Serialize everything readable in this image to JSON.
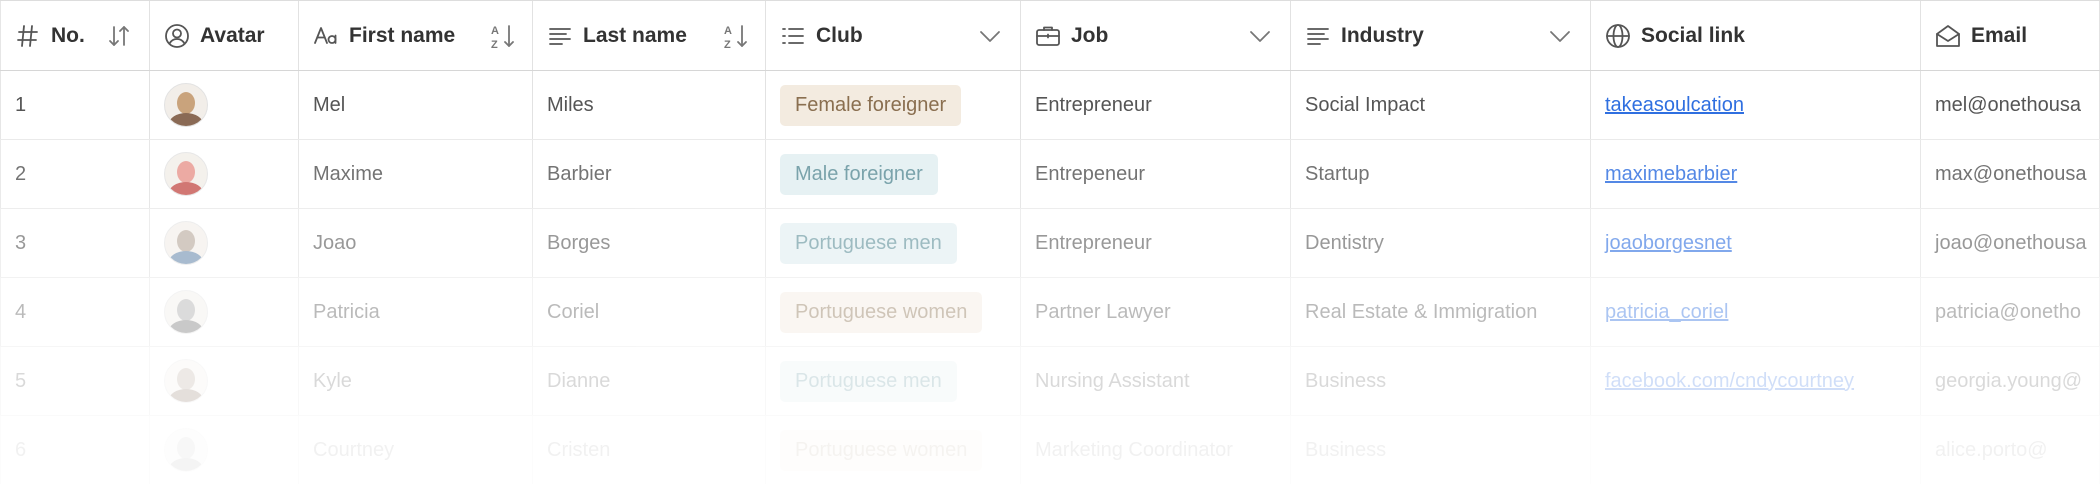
{
  "columns": [
    {
      "key": "no",
      "label": "No.",
      "icon": "hash-icon",
      "action": "sort-icon"
    },
    {
      "key": "avatar",
      "label": "Avatar",
      "icon": "user-circle-icon",
      "action": ""
    },
    {
      "key": "first_name",
      "label": "First name",
      "icon": "text-aa-icon",
      "action": "sort-az-icon"
    },
    {
      "key": "last_name",
      "label": "Last name",
      "icon": "text-lines-icon",
      "action": "sort-az-icon"
    },
    {
      "key": "club",
      "label": "Club",
      "icon": "list-icon",
      "action": "chevron-down-icon"
    },
    {
      "key": "job",
      "label": "Job",
      "icon": "briefcase-icon",
      "action": "chevron-down-icon"
    },
    {
      "key": "industry",
      "label": "Industry",
      "icon": "text-lines-icon",
      "action": "chevron-down-icon"
    },
    {
      "key": "social",
      "label": "Social link",
      "icon": "globe-icon",
      "action": ""
    },
    {
      "key": "email",
      "label": "Email",
      "icon": "envelope-open-icon",
      "action": ""
    }
  ],
  "rows": [
    {
      "no": "1",
      "first_name": "Mel",
      "last_name": "Miles",
      "club": "Female foreigner",
      "job": "Entrepreneur",
      "industry": "Social Impact",
      "social": "takeasoulcation",
      "email": "mel@onethousa",
      "avatar_colors": [
        "#c9a37c",
        "#8a6a55"
      ],
      "opacity": 1.0
    },
    {
      "no": "2",
      "first_name": "Maxime",
      "last_name": "Barbier",
      "club": "Male foreigner",
      "job": "Entrepeneur",
      "industry": "Startup",
      "social": "maximebarbier",
      "email": "max@onethousa",
      "avatar_colors": [
        "#e89890",
        "#c85a55"
      ],
      "opacity": 0.82
    },
    {
      "no": "3",
      "first_name": "Joao",
      "last_name": "Borges",
      "club": "Portuguese men",
      "job": "Entrepreneur",
      "industry": "Dentistry",
      "social": "joaoborgesnet",
      "email": "joao@onethousa",
      "avatar_colors": [
        "#b7a89a",
        "#6f8fb0"
      ],
      "opacity": 0.6
    },
    {
      "no": "4",
      "first_name": "Patricia",
      "last_name": "Coriel",
      "club": "Portuguese women",
      "job": "Partner Lawyer",
      "industry": "Real Estate & Immigration",
      "social": "patricia_coriel",
      "email": "patricia@onetho",
      "avatar_colors": [
        "#a8a8a8",
        "#7a7a7a"
      ],
      "opacity": 0.4
    },
    {
      "no": "5",
      "first_name": "Kyle",
      "last_name": "Dianne",
      "club": "Portuguese men",
      "job": "Nursing Assistant",
      "industry": "Business",
      "social": "facebook.com/cndycourtney",
      "email": "georgia.young@",
      "avatar_colors": [
        "#b0a090",
        "#8a7060"
      ],
      "opacity": 0.22
    },
    {
      "no": "6",
      "first_name": "Courtney",
      "last_name": "Cristen",
      "club": "Portuguese women",
      "job": "Marketing Coordinator",
      "industry": "Business",
      "social": "",
      "email": "alice.porto@",
      "avatar_colors": [
        "#a0a0a0",
        "#808080"
      ],
      "opacity": 0.08
    }
  ],
  "club_colors": {
    "Female foreigner": {
      "bg": "#f3ebe0",
      "fg": "#8a6f50"
    },
    "Male foreigner": {
      "bg": "#e1eef1",
      "fg": "#5d8f99"
    },
    "Portuguese men": {
      "bg": "#e1eef1",
      "fg": "#5d8f99"
    },
    "Portuguese women": {
      "bg": "#f3ebe0",
      "fg": "#8a6f50"
    }
  },
  "theme": {
    "link_color": "#2f6fe0",
    "text_color": "#555555",
    "header_text_color": "#333333"
  }
}
